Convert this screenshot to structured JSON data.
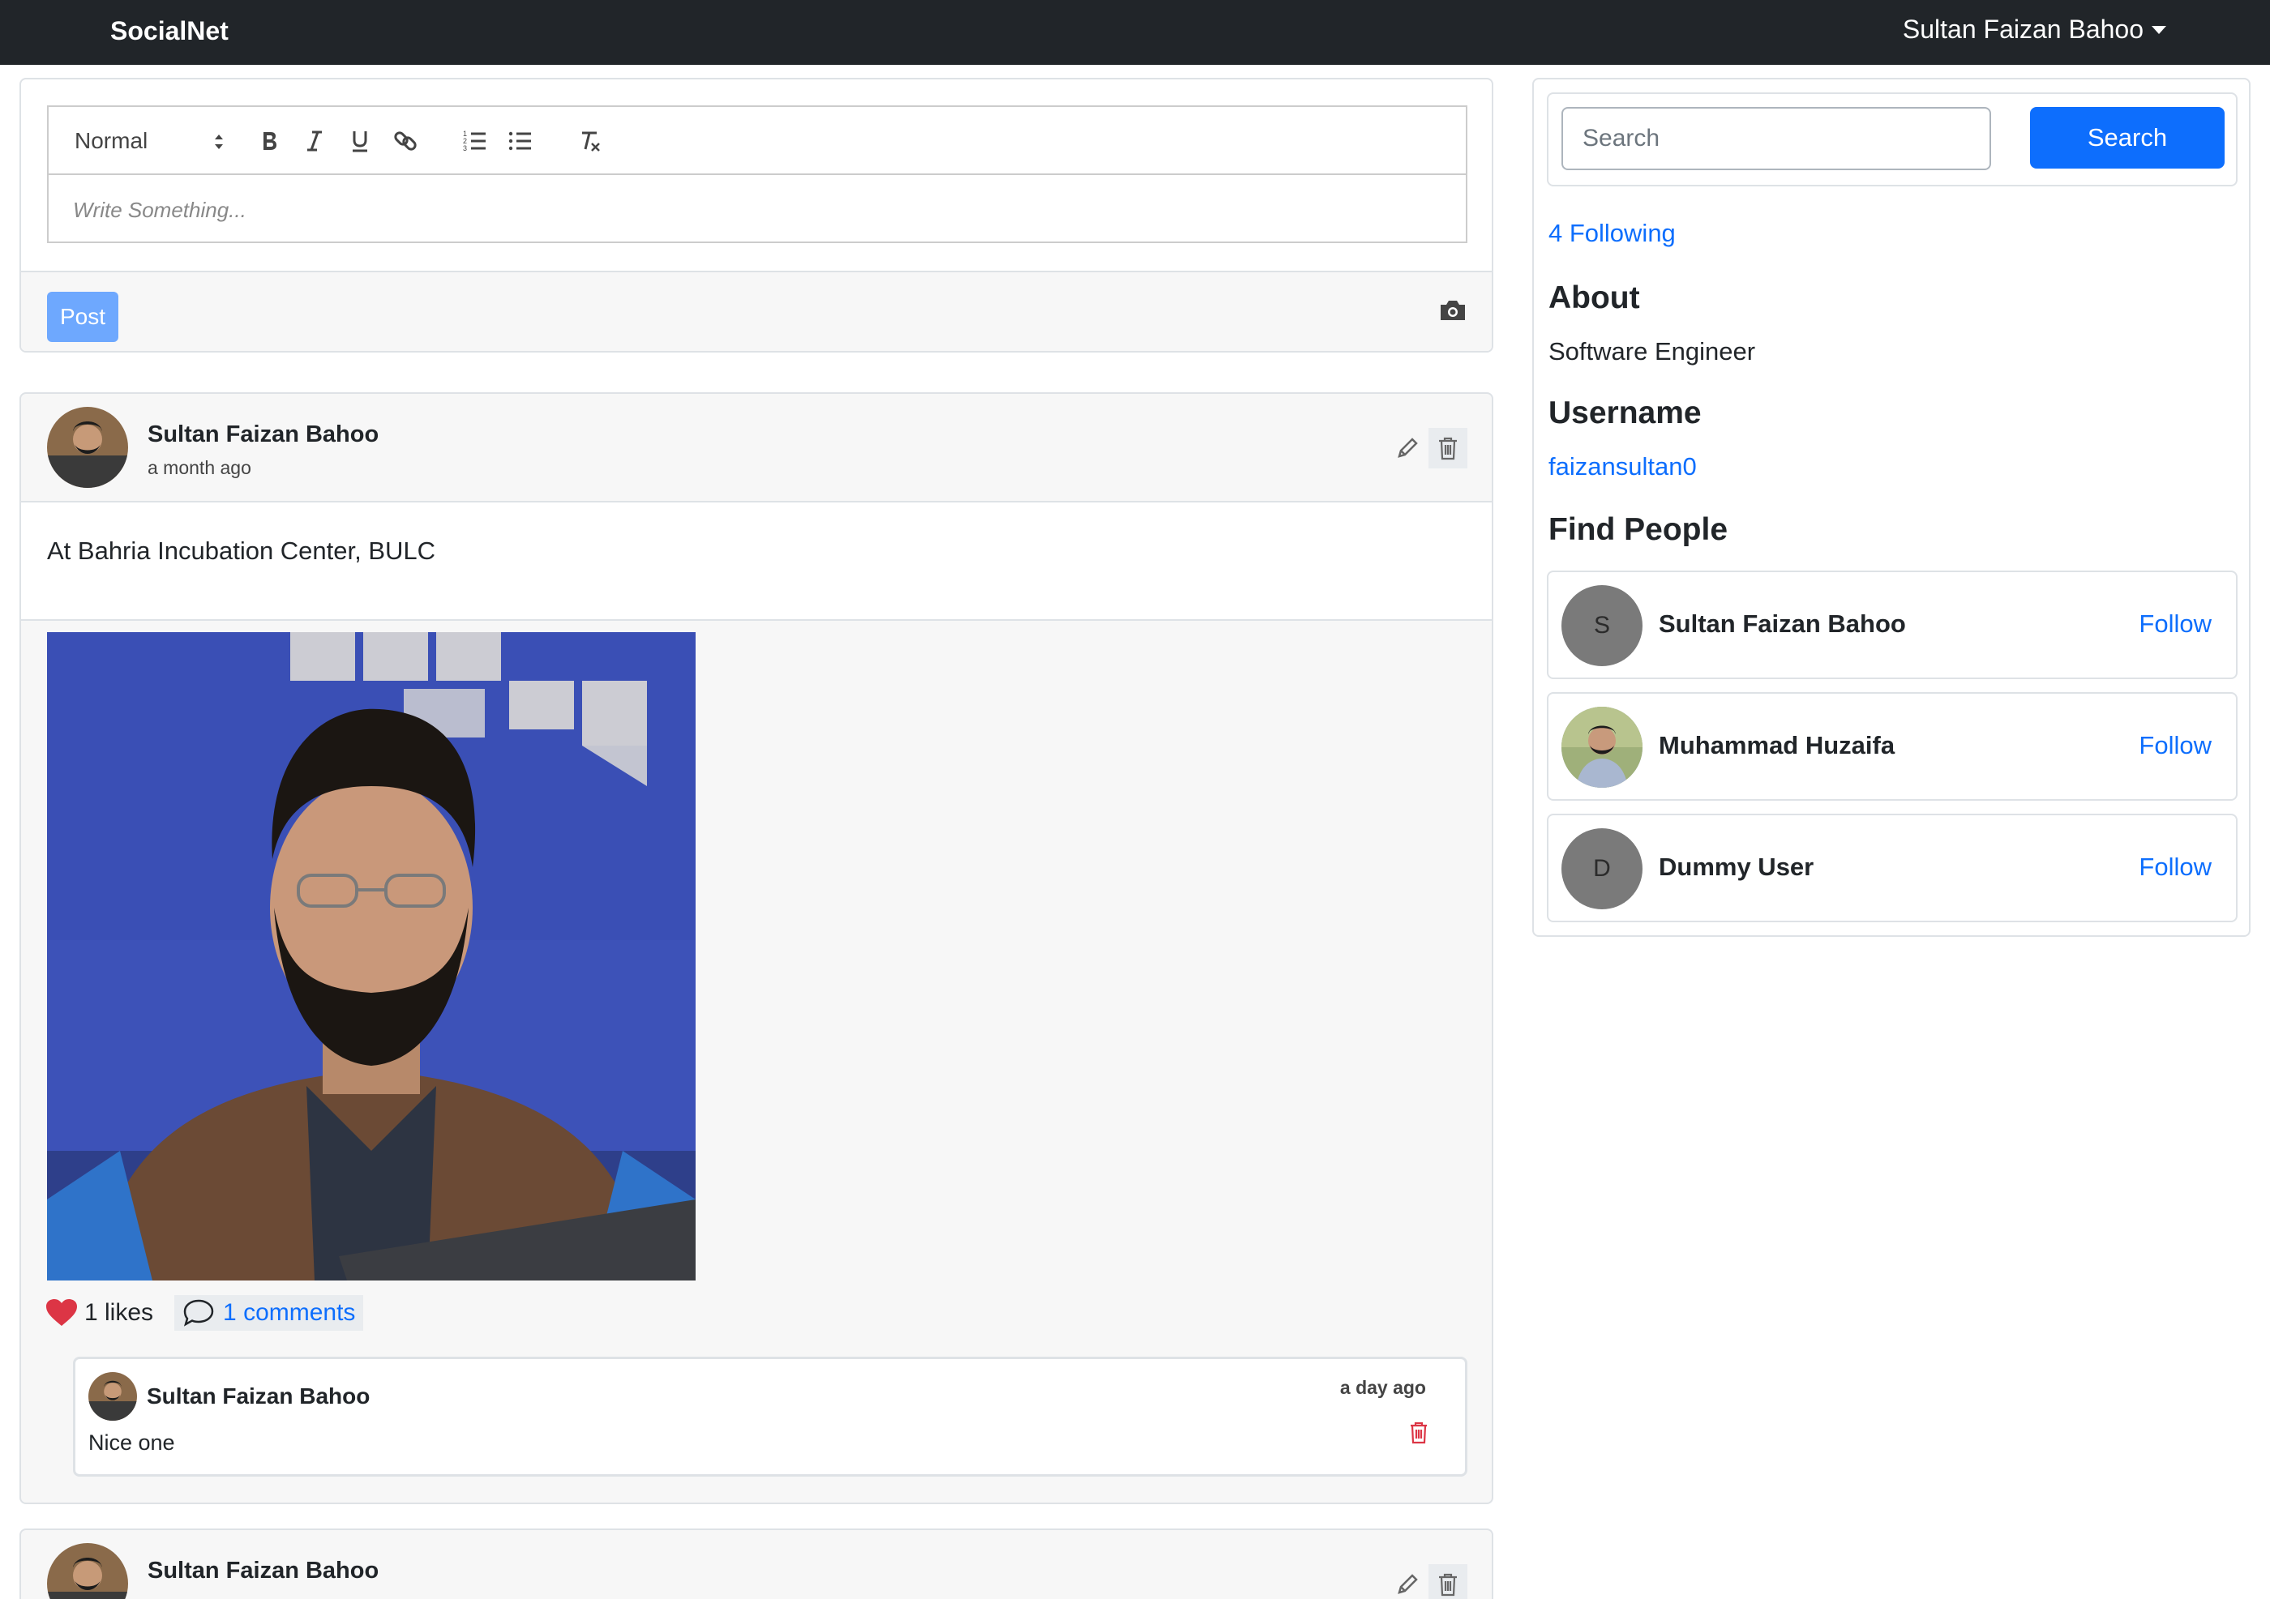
{
  "navbar": {
    "brand": "SocialNet",
    "user_name": "Sultan Faizan Bahoo"
  },
  "composer": {
    "format_select": "Normal",
    "placeholder": "Write Something...",
    "post_label": "Post",
    "toolbar_icons": [
      "bold-icon",
      "italic-icon",
      "underline-icon",
      "link-icon",
      "ordered-list-icon",
      "bullet-list-icon",
      "clear-format-icon"
    ]
  },
  "posts": [
    {
      "author": "Sultan Faizan Bahoo",
      "time": "a month ago",
      "text": "At Bahria Incubation Center, BULC",
      "likes": "1 likes",
      "comments_label": "1 comments",
      "comments": [
        {
          "author": "Sultan Faizan Bahoo",
          "time": "a day ago",
          "text": "Nice one"
        }
      ]
    },
    {
      "author": "Sultan Faizan Bahoo"
    }
  ],
  "sidebar": {
    "search_placeholder": "Search",
    "search_button": "Search",
    "following": "4 Following",
    "about_title": "About",
    "about_value": "Software Engineer",
    "username_title": "Username",
    "username_value": "faizansultan0",
    "find_people_title": "Find People",
    "people": [
      {
        "initial": "S",
        "name": "Sultan Faizan Bahoo",
        "action": "Follow"
      },
      {
        "initial": "",
        "name": "Muhammad Huzaifa",
        "action": "Follow"
      },
      {
        "initial": "D",
        "name": "Dummy User",
        "action": "Follow"
      }
    ]
  },
  "colors": {
    "navbar": "#212529",
    "primary": "#0d6efd",
    "post_button": "#6ea8fe",
    "like_heart": "#dc3545"
  }
}
